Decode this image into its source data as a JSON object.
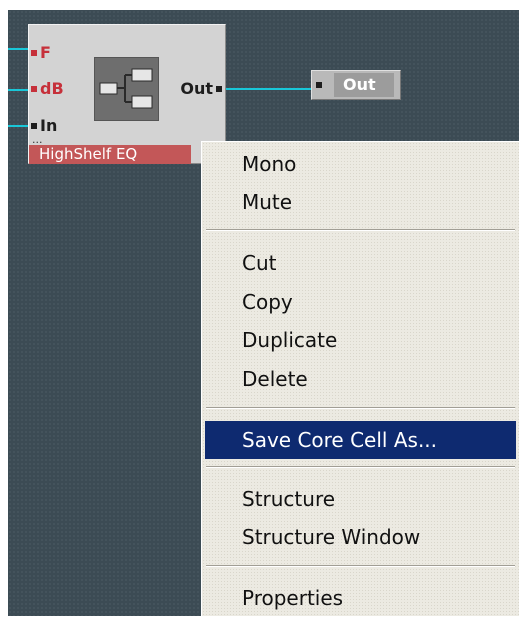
{
  "module": {
    "title": "HighShelf EQ",
    "inputs": [
      {
        "label": "F"
      },
      {
        "label": "dB"
      },
      {
        "label": "In"
      }
    ],
    "extra_ports": "...",
    "output_label": "Out"
  },
  "out_module": {
    "label": "Out"
  },
  "context_menu": {
    "items": [
      {
        "label": "Mono"
      },
      {
        "label": "Mute"
      },
      {
        "label": "Cut"
      },
      {
        "label": "Copy"
      },
      {
        "label": "Duplicate"
      },
      {
        "label": "Delete"
      },
      {
        "label": "Save Core Cell As..."
      },
      {
        "label": "Structure"
      },
      {
        "label": "Structure Window"
      },
      {
        "label": "Properties"
      }
    ],
    "highlighted_item": "Save Core Cell As..."
  },
  "colors": {
    "canvas": "#3c4b54",
    "wire": "#19c7d8",
    "title_bar": "#c35758",
    "port_red": "#c6303a",
    "highlight": "#0e2a70",
    "menu_bg": "#eceae2"
  }
}
